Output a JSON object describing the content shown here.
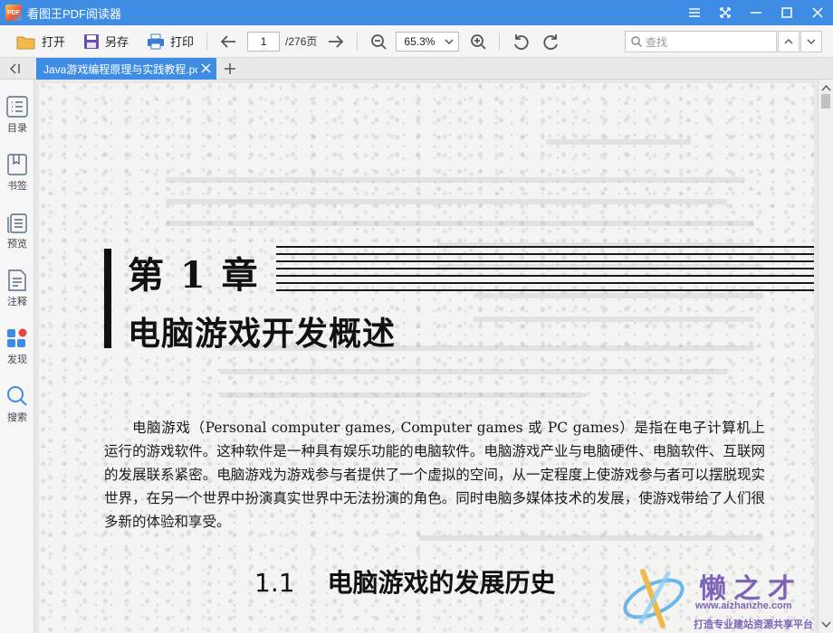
{
  "window": {
    "app_logo_text": "PDF",
    "title": "看图王PDF阅读器"
  },
  "toolbar": {
    "open_label": "打开",
    "save_as_label": "另存",
    "print_label": "打印",
    "current_page": "1",
    "total_pages": "/276页",
    "zoom": "65.3%",
    "search_placeholder": "查找"
  },
  "tabs": [
    {
      "label": "Java游戏编程原理与实践教程.pdf",
      "active": true
    }
  ],
  "sidebar": {
    "items": [
      {
        "label": "目录",
        "icon": "list-icon"
      },
      {
        "label": "书签",
        "icon": "bookmark-icon"
      },
      {
        "label": "预览",
        "icon": "preview-icon"
      },
      {
        "label": "注释",
        "icon": "annotation-icon"
      },
      {
        "label": "发现",
        "icon": "discover-icon"
      },
      {
        "label": "搜索",
        "icon": "search-icon"
      }
    ]
  },
  "document": {
    "chapter_number": "第 1 章",
    "chapter_title": "电脑游戏开发概述",
    "paragraph": "电脑游戏（Personal computer games, Computer games 或 PC games）是指在电子计算机上运行的游戏软件。这种软件是一种具有娱乐功能的电脑软件。电脑游戏产业与电脑硬件、电脑软件、互联网的发展联系紧密。电脑游戏为游戏参与者提供了一个虚拟的空间，从一定程度上使游戏参与者可以摆脱现实世界，在另一个世界中扮演真实世界中无法扮演的角色。同时电脑多媒体技术的发展，使游戏带给了人们很多新的体验和享受。",
    "section_number": "1.1",
    "section_title": "电脑游戏的发展历史"
  },
  "watermark": {
    "brand": "懒之才",
    "url": "www.aizhanzhe.com",
    "slogan": "打造专业建站资源共享平台"
  },
  "colors": {
    "accent": "#3e8ce4",
    "watermark": "#7e63b8"
  }
}
